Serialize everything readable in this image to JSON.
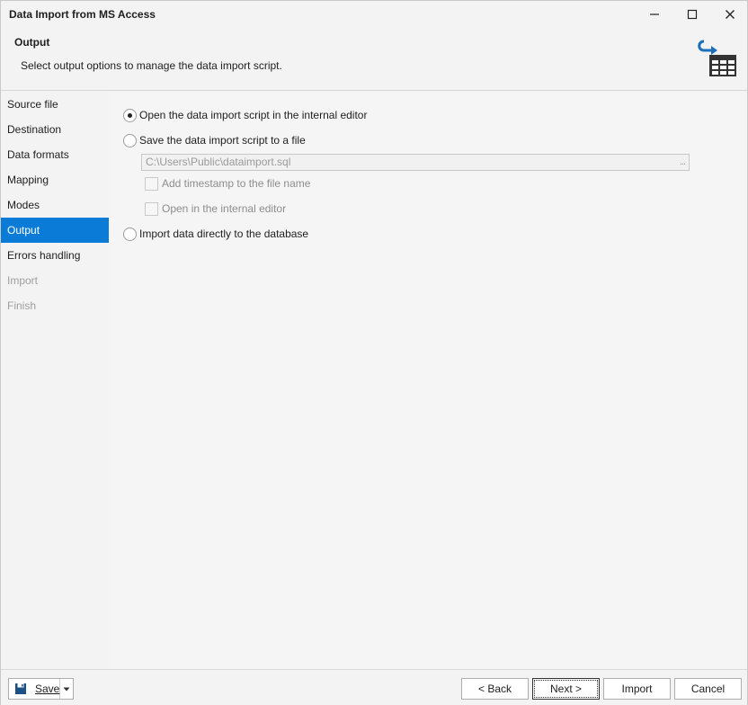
{
  "window": {
    "title": "Data Import from MS Access"
  },
  "header": {
    "title": "Output",
    "description": "Select output options to manage the data import script."
  },
  "sidebar": {
    "items": [
      {
        "label": "Source file"
      },
      {
        "label": "Destination"
      },
      {
        "label": "Data formats"
      },
      {
        "label": "Mapping"
      },
      {
        "label": "Modes"
      },
      {
        "label": "Output"
      },
      {
        "label": "Errors handling"
      },
      {
        "label": "Import"
      },
      {
        "label": "Finish"
      }
    ],
    "active": "Output",
    "disabled": [
      "Import",
      "Finish"
    ]
  },
  "options": {
    "open_internal_label": "Open the data import script in the internal editor",
    "open_internal_selected": true,
    "save_file_label": "Save the data import script to a file",
    "file_path": "C:\\Users\\Public\\dataimport.sql",
    "file_browse": "...",
    "add_timestamp_label": "Add timestamp to the file name",
    "open_in_editor_label": "Open in the internal editor",
    "import_directly_label": "Import data directly to the database"
  },
  "footer": {
    "save_label": "Save",
    "back_label": "< Back",
    "next_label": "Next >",
    "import_label": "Import",
    "cancel_label": "Cancel"
  },
  "colors": {
    "accent": "#0a7bd7",
    "icon_blue": "#1b6fb8",
    "icon_dark": "#333333"
  }
}
